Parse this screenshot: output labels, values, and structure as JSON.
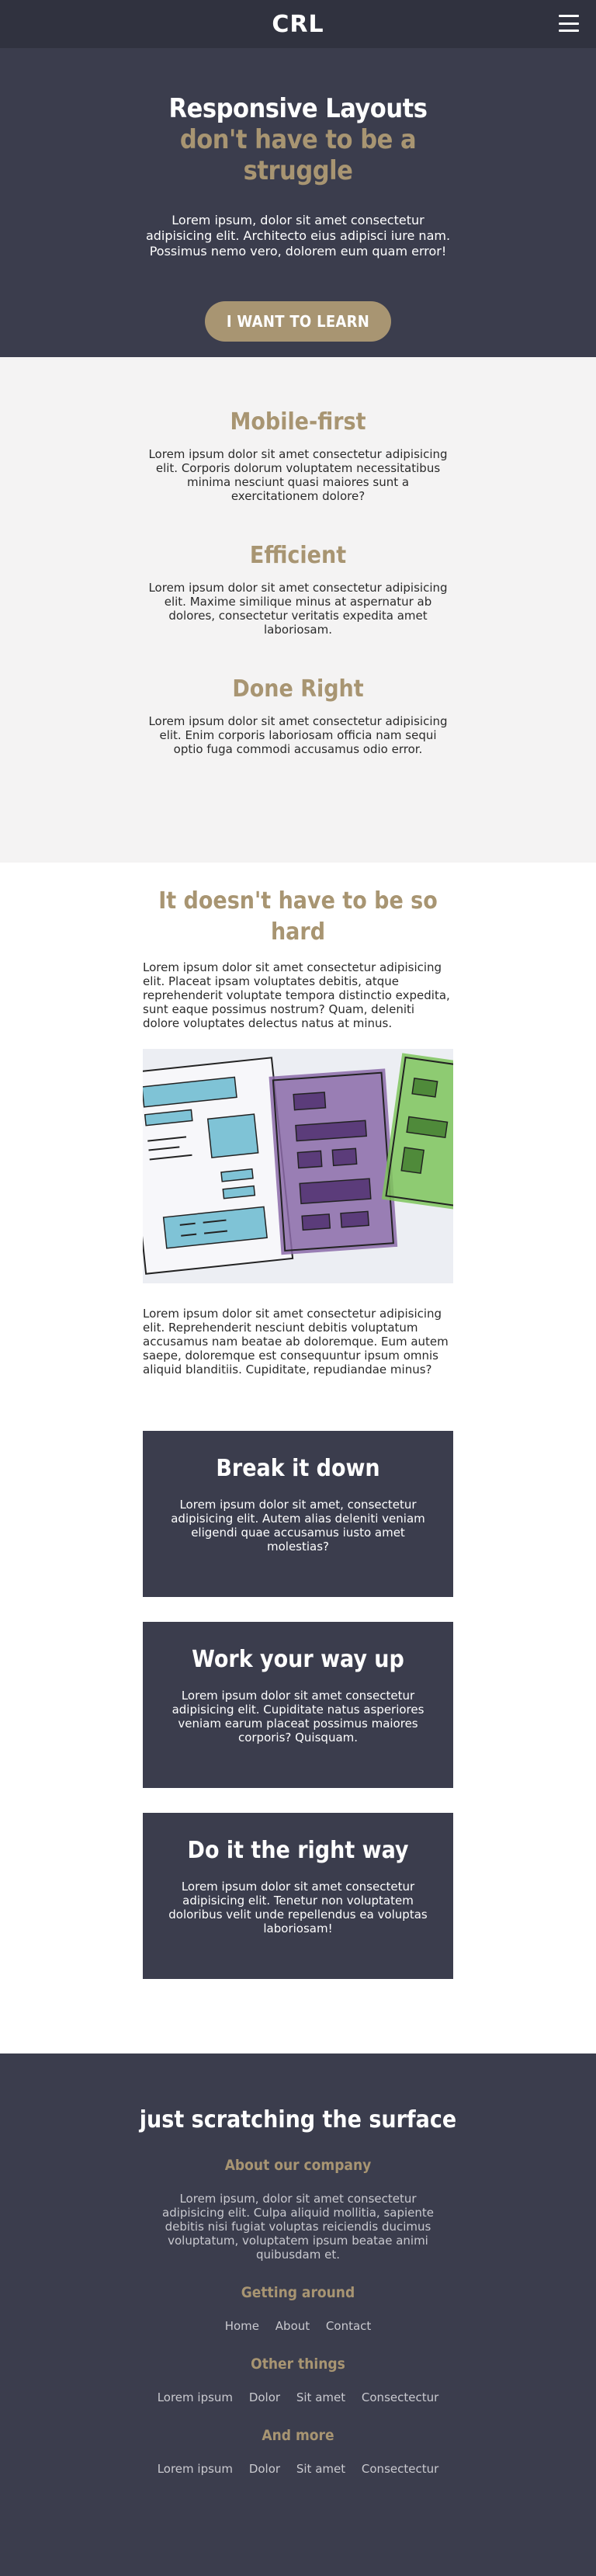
{
  "nav": {
    "logo": "CRL"
  },
  "hero": {
    "title_main": "Responsive Layouts ",
    "title_accent": "don't have to be a struggle",
    "text": "Lorem ipsum, dolor sit amet consectetur adipisicing elit. Architecto eius adipisci iure nam. Possimus nemo vero, dolorem eum quam error!",
    "button": "I WANT TO LEARN"
  },
  "features": [
    {
      "title": "Mobile-first",
      "text": "Lorem ipsum dolor sit amet consectetur adipisicing elit. Corporis dolorum voluptatem necessitatibus minima nesciunt quasi maiores sunt a exercitationem dolore?"
    },
    {
      "title": "Efficient",
      "text": "Lorem ipsum dolor sit amet consectetur adipisicing elit. Maxime similique minus at aspernatur ab dolores, consectetur veritatis expedita amet laboriosam."
    },
    {
      "title": "Done Right",
      "text": "Lorem ipsum dolor sit amet consectetur adipisicing elit. Enim corporis laboriosam officia nam sequi optio fuga commodi accusamus odio error."
    }
  ],
  "content": {
    "title": "It doesn't have to be so hard",
    "p1": "Lorem ipsum dolor sit amet consectetur adipisicing elit. Placeat ipsam voluptates debitis, atque reprehenderit voluptate tempora distinctio expedita, sunt eaque possimus nostrum? Quam, deleniti dolore voluptates delectus natus at minus.",
    "p2": "Lorem ipsum dolor sit amet consectetur adipisicing elit. Reprehenderit nesciunt debitis voluptatum accusamus nam beatae ab doloremque. Eum autem saepe, doloremque est consequuntur ipsum omnis aliquid blanditiis. Cupiditate, repudiandae minus?"
  },
  "cards": [
    {
      "title": "Break it down",
      "text": "Lorem ipsum dolor sit amet, consectetur adipisicing elit. Autem alias deleniti veniam eligendi quae accusamus iusto amet molestias?"
    },
    {
      "title": "Work your way up",
      "text": "Lorem ipsum dolor sit amet consectetur adipisicing elit. Cupiditate natus asperiores veniam earum placeat possimus maiores corporis? Quisquam."
    },
    {
      "title": "Do it the right way",
      "text": "Lorem ipsum dolor sit amet consectetur adipisicing elit. Tenetur non voluptatem doloribus velit unde repellendus ea voluptas laboriosam!"
    }
  ],
  "footer": {
    "title": "just scratching the surface",
    "about_heading": "About our company",
    "about_text": "Lorem ipsum, dolor sit amet consectetur adipisicing elit. Culpa aliquid mollitia, sapiente debitis nisi fugiat voluptas reiciendis ducimus voluptatum, voluptatem ipsum beatae animi quibusdam et.",
    "getting_around_heading": "Getting around",
    "getting_around_links": [
      "Home",
      "About",
      "Contact"
    ],
    "other_heading": "Other things",
    "other_links": [
      "Lorem ipsum",
      "Dolor",
      "Sit amet",
      "Consectectur"
    ],
    "more_heading": "And more",
    "more_links": [
      "Lorem ipsum",
      "Dolor",
      "Sit amet",
      "Consectectur"
    ]
  },
  "colors": {
    "accent": "#a89572",
    "dark": "#3b3d4d",
    "nav": "#30323f",
    "light": "#f4f3f3"
  },
  "icons": {
    "menu": "hamburger-menu-icon"
  }
}
